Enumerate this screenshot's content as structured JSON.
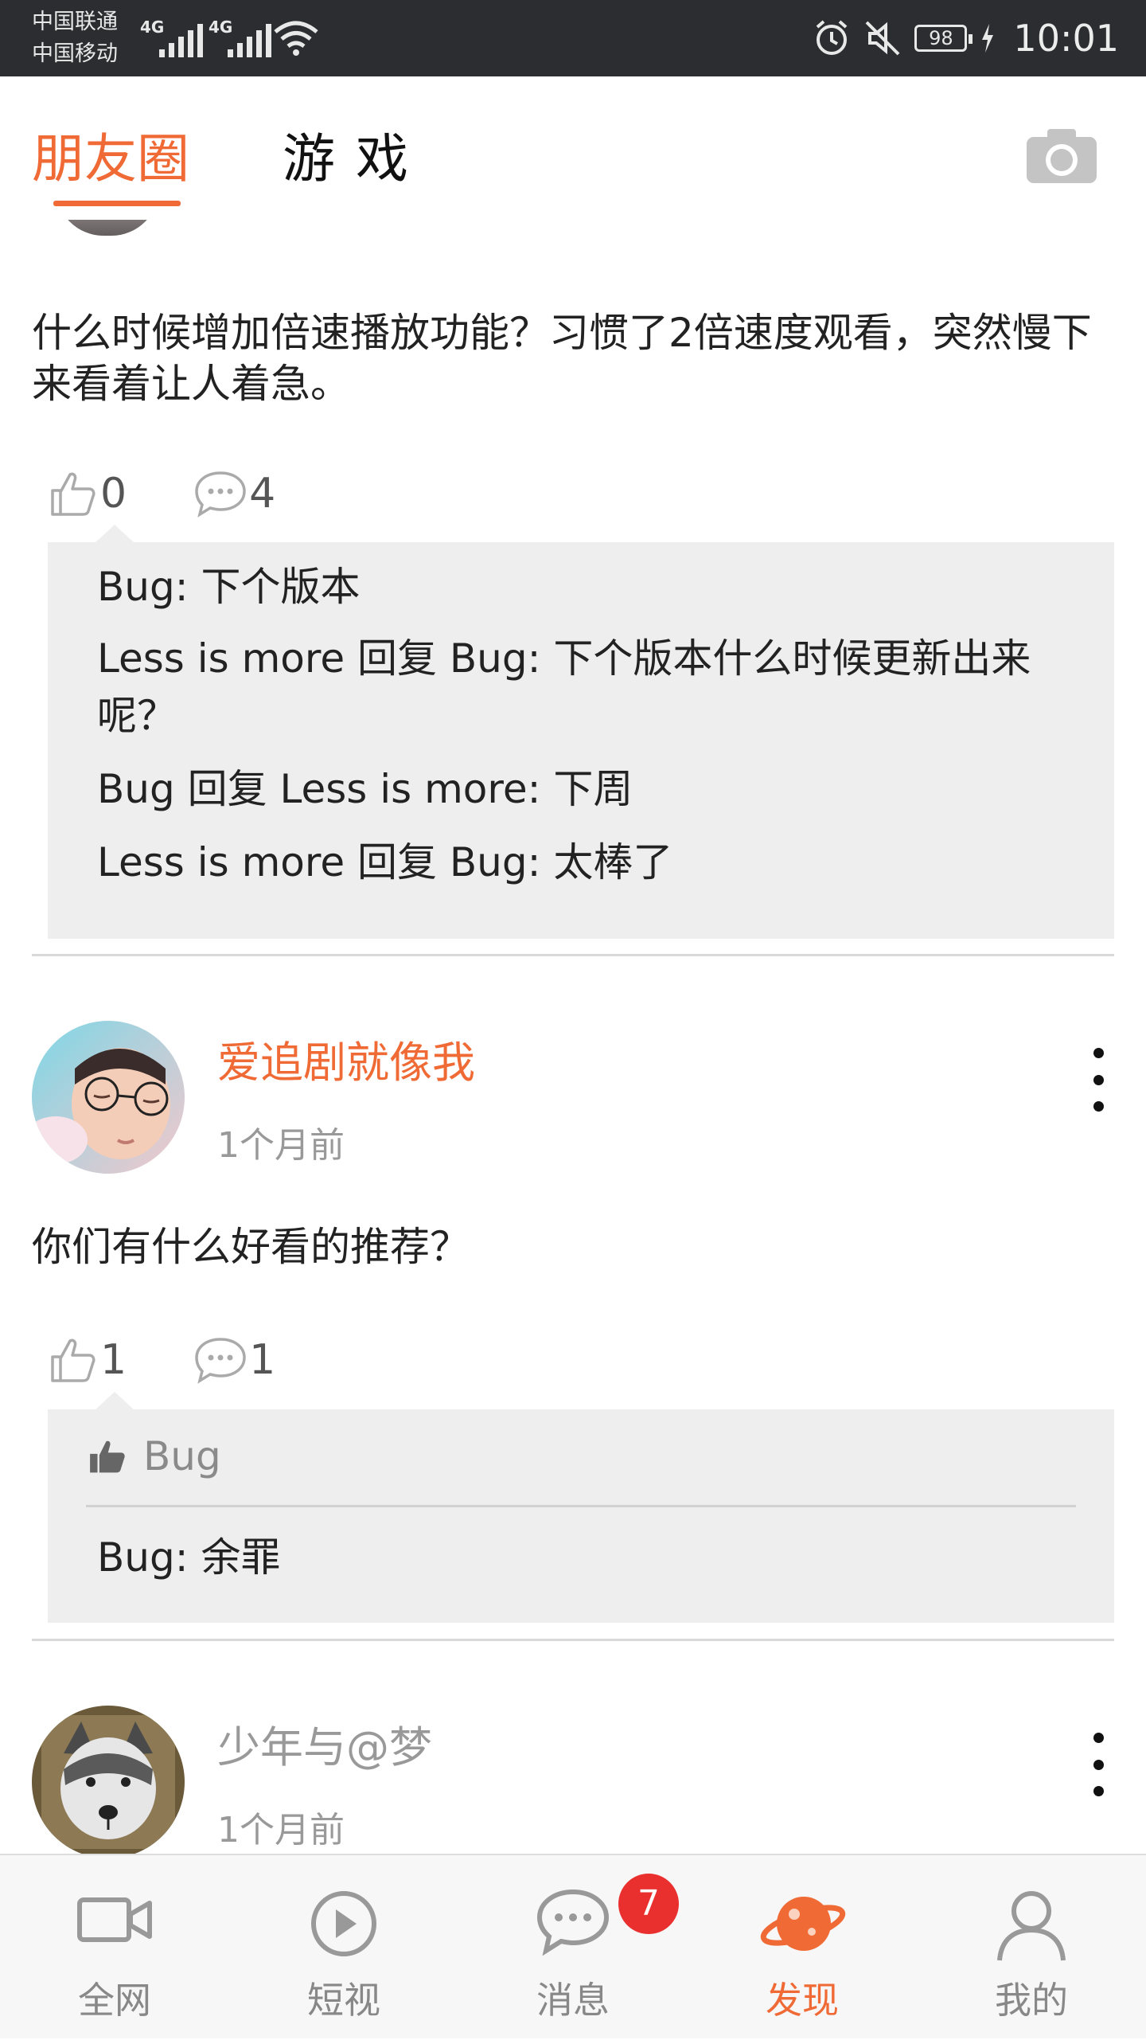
{
  "status_bar": {
    "carrier_1": "中国联通",
    "carrier_2": "中国移动",
    "network_1": "4G",
    "network_2": "4G",
    "battery": "98",
    "time": "10:01"
  },
  "top_tabs": {
    "active_tab": "朋友圈",
    "other_tab": "游戏",
    "camera_icon": "camera-icon"
  },
  "posts": [
    {
      "text": "什么时候增加倍速播放功能？习惯了2倍速度观看，突然慢下来看着让人着急。",
      "likes": "0",
      "comments_count": "4",
      "comments": [
        "Bug: 下个版本",
        "Less is more 回复 Bug: 下个版本什么时候更新出来呢？",
        "Bug 回复 Less is more: 下周",
        "Less is more 回复 Bug: 太棒了"
      ]
    },
    {
      "username": "爱追剧就像我",
      "time": "1个月前",
      "text": "你们有什么好看的推荐？",
      "likes": "1",
      "comments_count": "1",
      "liked_by": "Bug",
      "comments": [
        "Bug: 余罪"
      ]
    },
    {
      "username": "少年与@梦",
      "time": "1个月前"
    }
  ],
  "bottom_nav": {
    "items": [
      {
        "label": "全网",
        "icon": "video-camera-icon"
      },
      {
        "label": "短视",
        "icon": "play-circle-icon"
      },
      {
        "label": "消息",
        "icon": "chat-bubble-icon",
        "badge": "7"
      },
      {
        "label": "发现",
        "icon": "planet-icon",
        "active": true
      },
      {
        "label": "我的",
        "icon": "person-icon"
      }
    ]
  },
  "colors": {
    "accent": "#f06a35",
    "status_bar": "#2b2d30",
    "comment_bg": "#eeeeee",
    "badge": "#e9302f"
  }
}
